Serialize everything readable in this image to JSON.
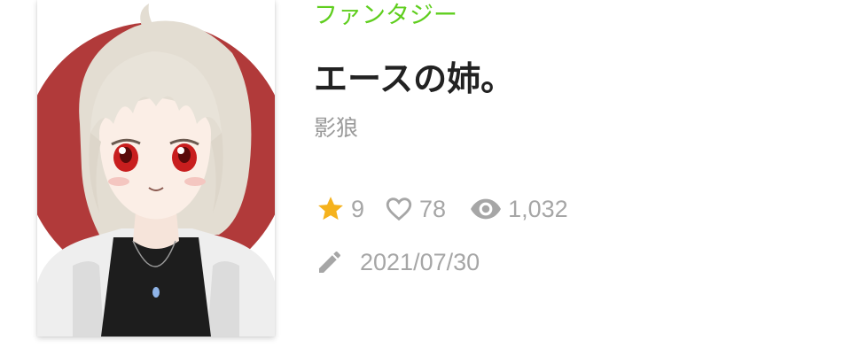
{
  "work": {
    "genre": "ファンタジー",
    "title": "エースの姉。",
    "author": "影狼",
    "stats": {
      "stars": "9",
      "likes": "78",
      "views": "1,032"
    },
    "updated": "2021/07/30"
  },
  "icons": {
    "star": "star-icon",
    "heart": "heart-outline-icon",
    "eye": "eye-icon",
    "pencil": "pencil-icon"
  },
  "colors": {
    "genre": "#5fce1e",
    "star": "#f5b21d",
    "muted": "#a6a6a6",
    "title": "#222222",
    "cover_circle": "#b13a3a"
  }
}
